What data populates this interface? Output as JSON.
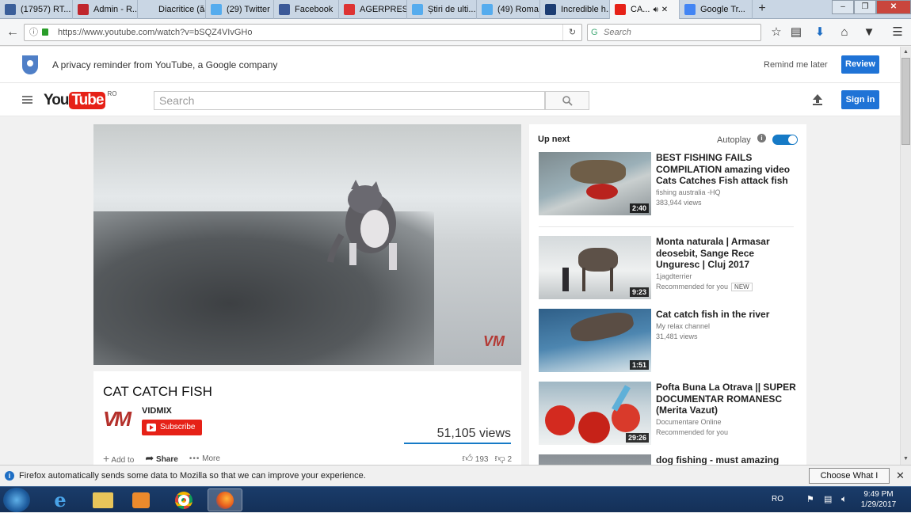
{
  "browser": {
    "tabs": [
      {
        "label": "(17957) RT...",
        "icon": "rt-icon",
        "color": "#3a5f9a"
      },
      {
        "label": "Admin - R...",
        "icon": "r-icon",
        "color": "#c0262d"
      },
      {
        "label": "Diacritice (ăâîșț...",
        "icon": "blank-icon",
        "color": "#c9d6e4"
      },
      {
        "label": "(29) Twitter",
        "icon": "twitter-icon",
        "color": "#55acee"
      },
      {
        "label": "Facebook",
        "icon": "facebook-icon",
        "color": "#3b5998"
      },
      {
        "label": "AGERPRES...",
        "icon": "agerpres-icon",
        "color": "#d33"
      },
      {
        "label": "Știri de ulti...",
        "icon": "news-icon",
        "color": "#55acee"
      },
      {
        "label": "(49) Roma...",
        "icon": "twitter-icon",
        "color": "#55acee"
      },
      {
        "label": "Incredible h...",
        "icon": "20-icon",
        "color": "#1c3d73"
      },
      {
        "label": "CA...",
        "icon": "youtube-icon",
        "color": "#e62117",
        "active": true
      },
      {
        "label": "Google Tr...",
        "icon": "google-icon",
        "color": "#4285f4"
      }
    ],
    "new_tab": "+",
    "window": {
      "minimize": "–",
      "restore": "❐",
      "close": "✕"
    },
    "url": "https://www.youtube.com/watch?v=bSQZ4VIvGHo",
    "search_placeholder": "Search"
  },
  "privacy": {
    "message": "A privacy reminder from YouTube, a Google company",
    "remind": "Remind me later",
    "review": "Review"
  },
  "masthead": {
    "logo_you": "You",
    "logo_tube": "Tube",
    "region": "RO",
    "search_placeholder": "Search",
    "signin": "Sign in"
  },
  "video": {
    "title": "CAT CATCH FISH",
    "watermark": "VM",
    "channel": "VIDMIX",
    "channel_logo": "VM",
    "subscribe": "Subscribe",
    "views": "51,105 views",
    "add_to": "Add to",
    "share": "Share",
    "more": "More",
    "likes": "193",
    "dislikes": "2"
  },
  "sidebar": {
    "up_next": "Up next",
    "autoplay": "Autoplay",
    "items": [
      {
        "title": "BEST FISHING FAILS COMPILATION amazing video Cats Catches Fish attack fish",
        "channel": "fishing australia -HQ",
        "meta": "383,944 views",
        "duration": "2:40",
        "badge": ""
      },
      {
        "title": "Monta naturala | Armasar deosebit, Sange Rece Unguresc | Cluj 2017",
        "channel": "1jagdterrier",
        "meta": "Recommended for you",
        "duration": "9:23",
        "badge": "NEW"
      },
      {
        "title": "Cat catch fish in the river",
        "channel": "My relax channel",
        "meta": "31,481 views",
        "duration": "1:51",
        "badge": ""
      },
      {
        "title": "Pofta Buna La Otrava || SUPER DOCUMENTAR ROMANESC (Merita Vazut)",
        "channel": "Documentare Online",
        "meta": "Recommended for you",
        "duration": "29:26",
        "badge": ""
      },
      {
        "title": "dog fishing - must amazing show",
        "channel": "",
        "meta": "",
        "duration": "",
        "badge": ""
      }
    ]
  },
  "notification": {
    "text": "Firefox automatically sends some data to Mozilla so that we can improve your experience.",
    "button": "Choose What I Share",
    "close": "✕"
  },
  "taskbar": {
    "language": "RO",
    "time": "9:49 PM",
    "date": "1/29/2017"
  }
}
